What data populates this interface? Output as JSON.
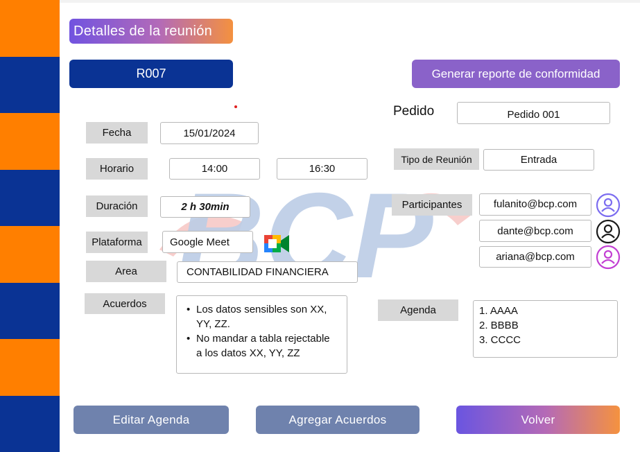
{
  "header": {
    "title": "Detalles de la reunión",
    "meeting_code": "R007",
    "report_button": "Generar reporte de conformidad"
  },
  "form": {
    "fecha": {
      "label": "Fecha",
      "value": "15/01/2024"
    },
    "horario": {
      "label": "Horario",
      "start": "14:00",
      "end": "16:30"
    },
    "duracion": {
      "label": "Duración",
      "value": "2 h 30min"
    },
    "plataforma": {
      "label": "Plataforma",
      "value": "Google Meet",
      "icon": "google-meet-icon"
    },
    "area": {
      "label": "Area",
      "value": "CONTABILIDAD FINANCIERA"
    },
    "acuerdos": {
      "label": "Acuerdos",
      "items": [
        {
          "line1": "Los datos sensibles son XX,",
          "line2": "YY, ZZ."
        },
        {
          "line1": "No mandar a tabla rejectable",
          "line2": "a los datos XX, YY, ZZ"
        }
      ]
    },
    "pedido": {
      "label": "Pedido",
      "value": "Pedido 001"
    },
    "tipo_reunion": {
      "label": "Tipo de Reunión",
      "value": "Entrada"
    },
    "participantes": {
      "label": "Participantes",
      "items": [
        {
          "email": "fulanito@bcp.com",
          "avatar_color": "#7b6cf0",
          "icon": "user-avatar-icon"
        },
        {
          "email": "dante@bcp.com",
          "avatar_color": "#1a1a1a",
          "icon": "user-avatar-icon"
        },
        {
          "email": "ariana@bcp.com",
          "avatar_color": "#c23fd3",
          "icon": "user-avatar-icon"
        }
      ]
    },
    "agenda": {
      "label": "Agenda",
      "items": [
        "1. AAAA",
        "2. BBBB",
        "3. CCCC"
      ]
    }
  },
  "actions": {
    "editar_agenda": "Editar Agenda",
    "agregar_acuerdos": "Agregar Acuerdos",
    "volver": "Volver"
  },
  "colors": {
    "stripe_orange": "#ff7f00",
    "stripe_blue": "#0a3394",
    "watermark_text": "BCP"
  }
}
